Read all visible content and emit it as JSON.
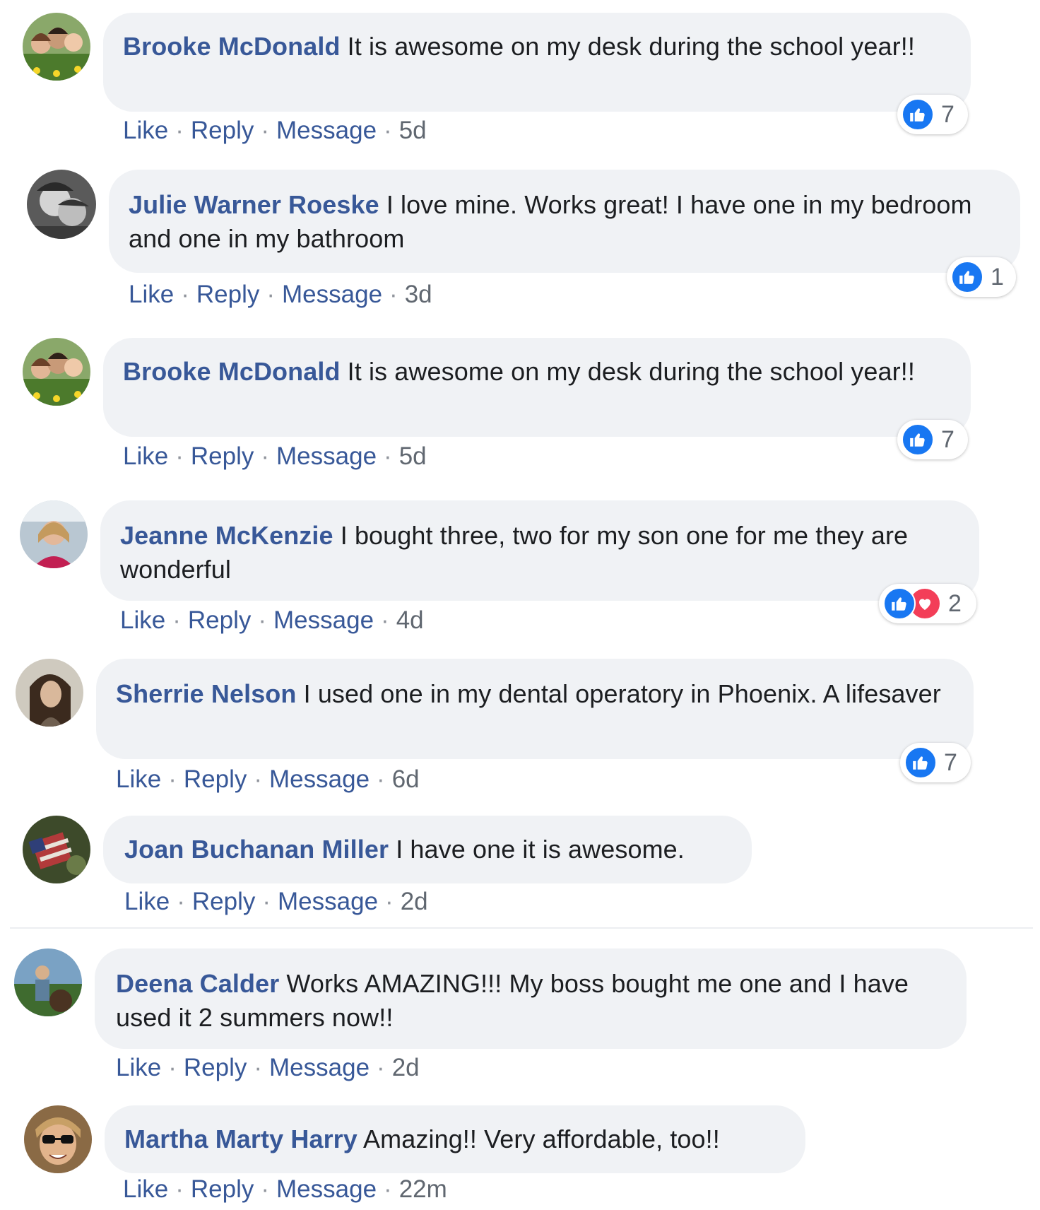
{
  "actions": {
    "like": "Like",
    "reply": "Reply",
    "message": "Message",
    "separator": "·"
  },
  "colors": {
    "link": "#385898",
    "bubble": "#f0f2f5",
    "like_reaction": "#1877f2",
    "love_reaction": "#f33e58"
  },
  "comments": [
    {
      "author": "Brooke McDonald",
      "text": "It is awesome on my desk during the school year!!",
      "time": "5d",
      "reaction_count": "7",
      "reactions": [
        "like-icon"
      ]
    },
    {
      "author": "Julie Warner Roeske",
      "text": "I love mine. Works great! I have one in my bedroom and one in my bathroom",
      "time": "3d",
      "reaction_count": "1",
      "reactions": [
        "like-icon"
      ]
    },
    {
      "author": "Brooke McDonald",
      "text": "It is awesome on my desk during the school year!!",
      "time": "5d",
      "reaction_count": "7",
      "reactions": [
        "like-icon"
      ]
    },
    {
      "author": "Jeanne McKenzie",
      "text": "I bought three, two for my son one for me they are wonderful",
      "time": "4d",
      "reaction_count": "2",
      "reactions": [
        "like-icon",
        "love-icon"
      ]
    },
    {
      "author": "Sherrie Nelson",
      "text": "I used one in my dental operatory in Phoenix. A lifesaver",
      "time": "6d",
      "reaction_count": "7",
      "reactions": [
        "like-icon"
      ]
    },
    {
      "author": "Joan Buchanan Miller",
      "text": "I have one it is awesome.",
      "time": "2d",
      "reaction_count": null,
      "reactions": []
    },
    {
      "author": "Deena Calder",
      "text": "Works AMAZING!!! My boss bought me one and I have used it 2 summers now!!",
      "time": "2d",
      "reaction_count": null,
      "reactions": []
    },
    {
      "author": "Martha Marty Harry",
      "text": "Amazing!! Very affordable, too!!",
      "time": "22m",
      "reaction_count": null,
      "reactions": []
    }
  ]
}
